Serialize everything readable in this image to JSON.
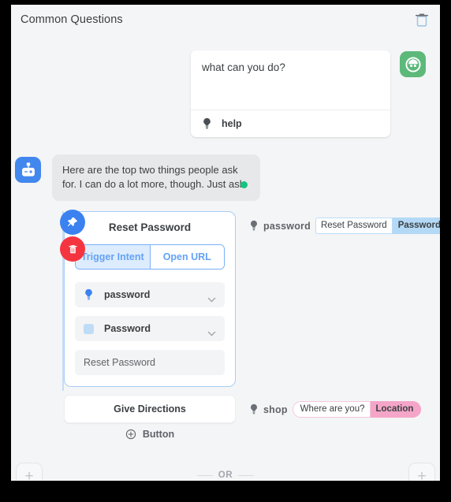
{
  "header": {
    "title": "Common Questions",
    "delete_icon": "trash-icon"
  },
  "user_message": {
    "text": "what can you do?",
    "intent_label": "help",
    "intent_icon": "lightbulb-icon",
    "avatar_icon": "user-avatar-icon",
    "avatar_color": "#5cb97a"
  },
  "bot_message": {
    "text": "Here are the top two things people ask for. I can do a lot more, though. Just ask",
    "avatar_icon": "robot-icon",
    "avatar_color": "#4287ee",
    "status_dot_color": "#15c47e"
  },
  "card": {
    "title": "Reset Password",
    "pin_icon": "pin-icon",
    "pin_color": "#3b82f0",
    "delete_icon": "trash-icon",
    "delete_color": "#f4353f",
    "tabs": [
      {
        "label": "Trigger Intent",
        "active": true
      },
      {
        "label": "Open URL",
        "active": false
      }
    ],
    "fields": [
      {
        "icon": "lightbulb-icon",
        "label": "password",
        "type": "dropdown"
      },
      {
        "icon": "color-swatch-icon",
        "label": "Password",
        "type": "dropdown"
      }
    ],
    "text_input_value": "Reset Password"
  },
  "annotations": [
    {
      "icon": "lightbulb-icon",
      "label": "password",
      "chips": [
        {
          "text": "Reset Password",
          "style": "blue-outline"
        },
        {
          "text": "Password",
          "style": "blue-fill"
        }
      ]
    },
    {
      "icon": "lightbulb-icon",
      "label": "shop",
      "chips": [
        {
          "text": "Where are you?",
          "style": "pink-outline"
        },
        {
          "text": "Location",
          "style": "pink-fill"
        }
      ]
    }
  ],
  "second_button": {
    "label": "Give Directions"
  },
  "add_button": {
    "label": "Button",
    "icon": "plus-circle-icon"
  },
  "footer": {
    "or_label": "OR",
    "left_add_icon": "plus-icon",
    "right_add_icon": "plus-icon"
  }
}
